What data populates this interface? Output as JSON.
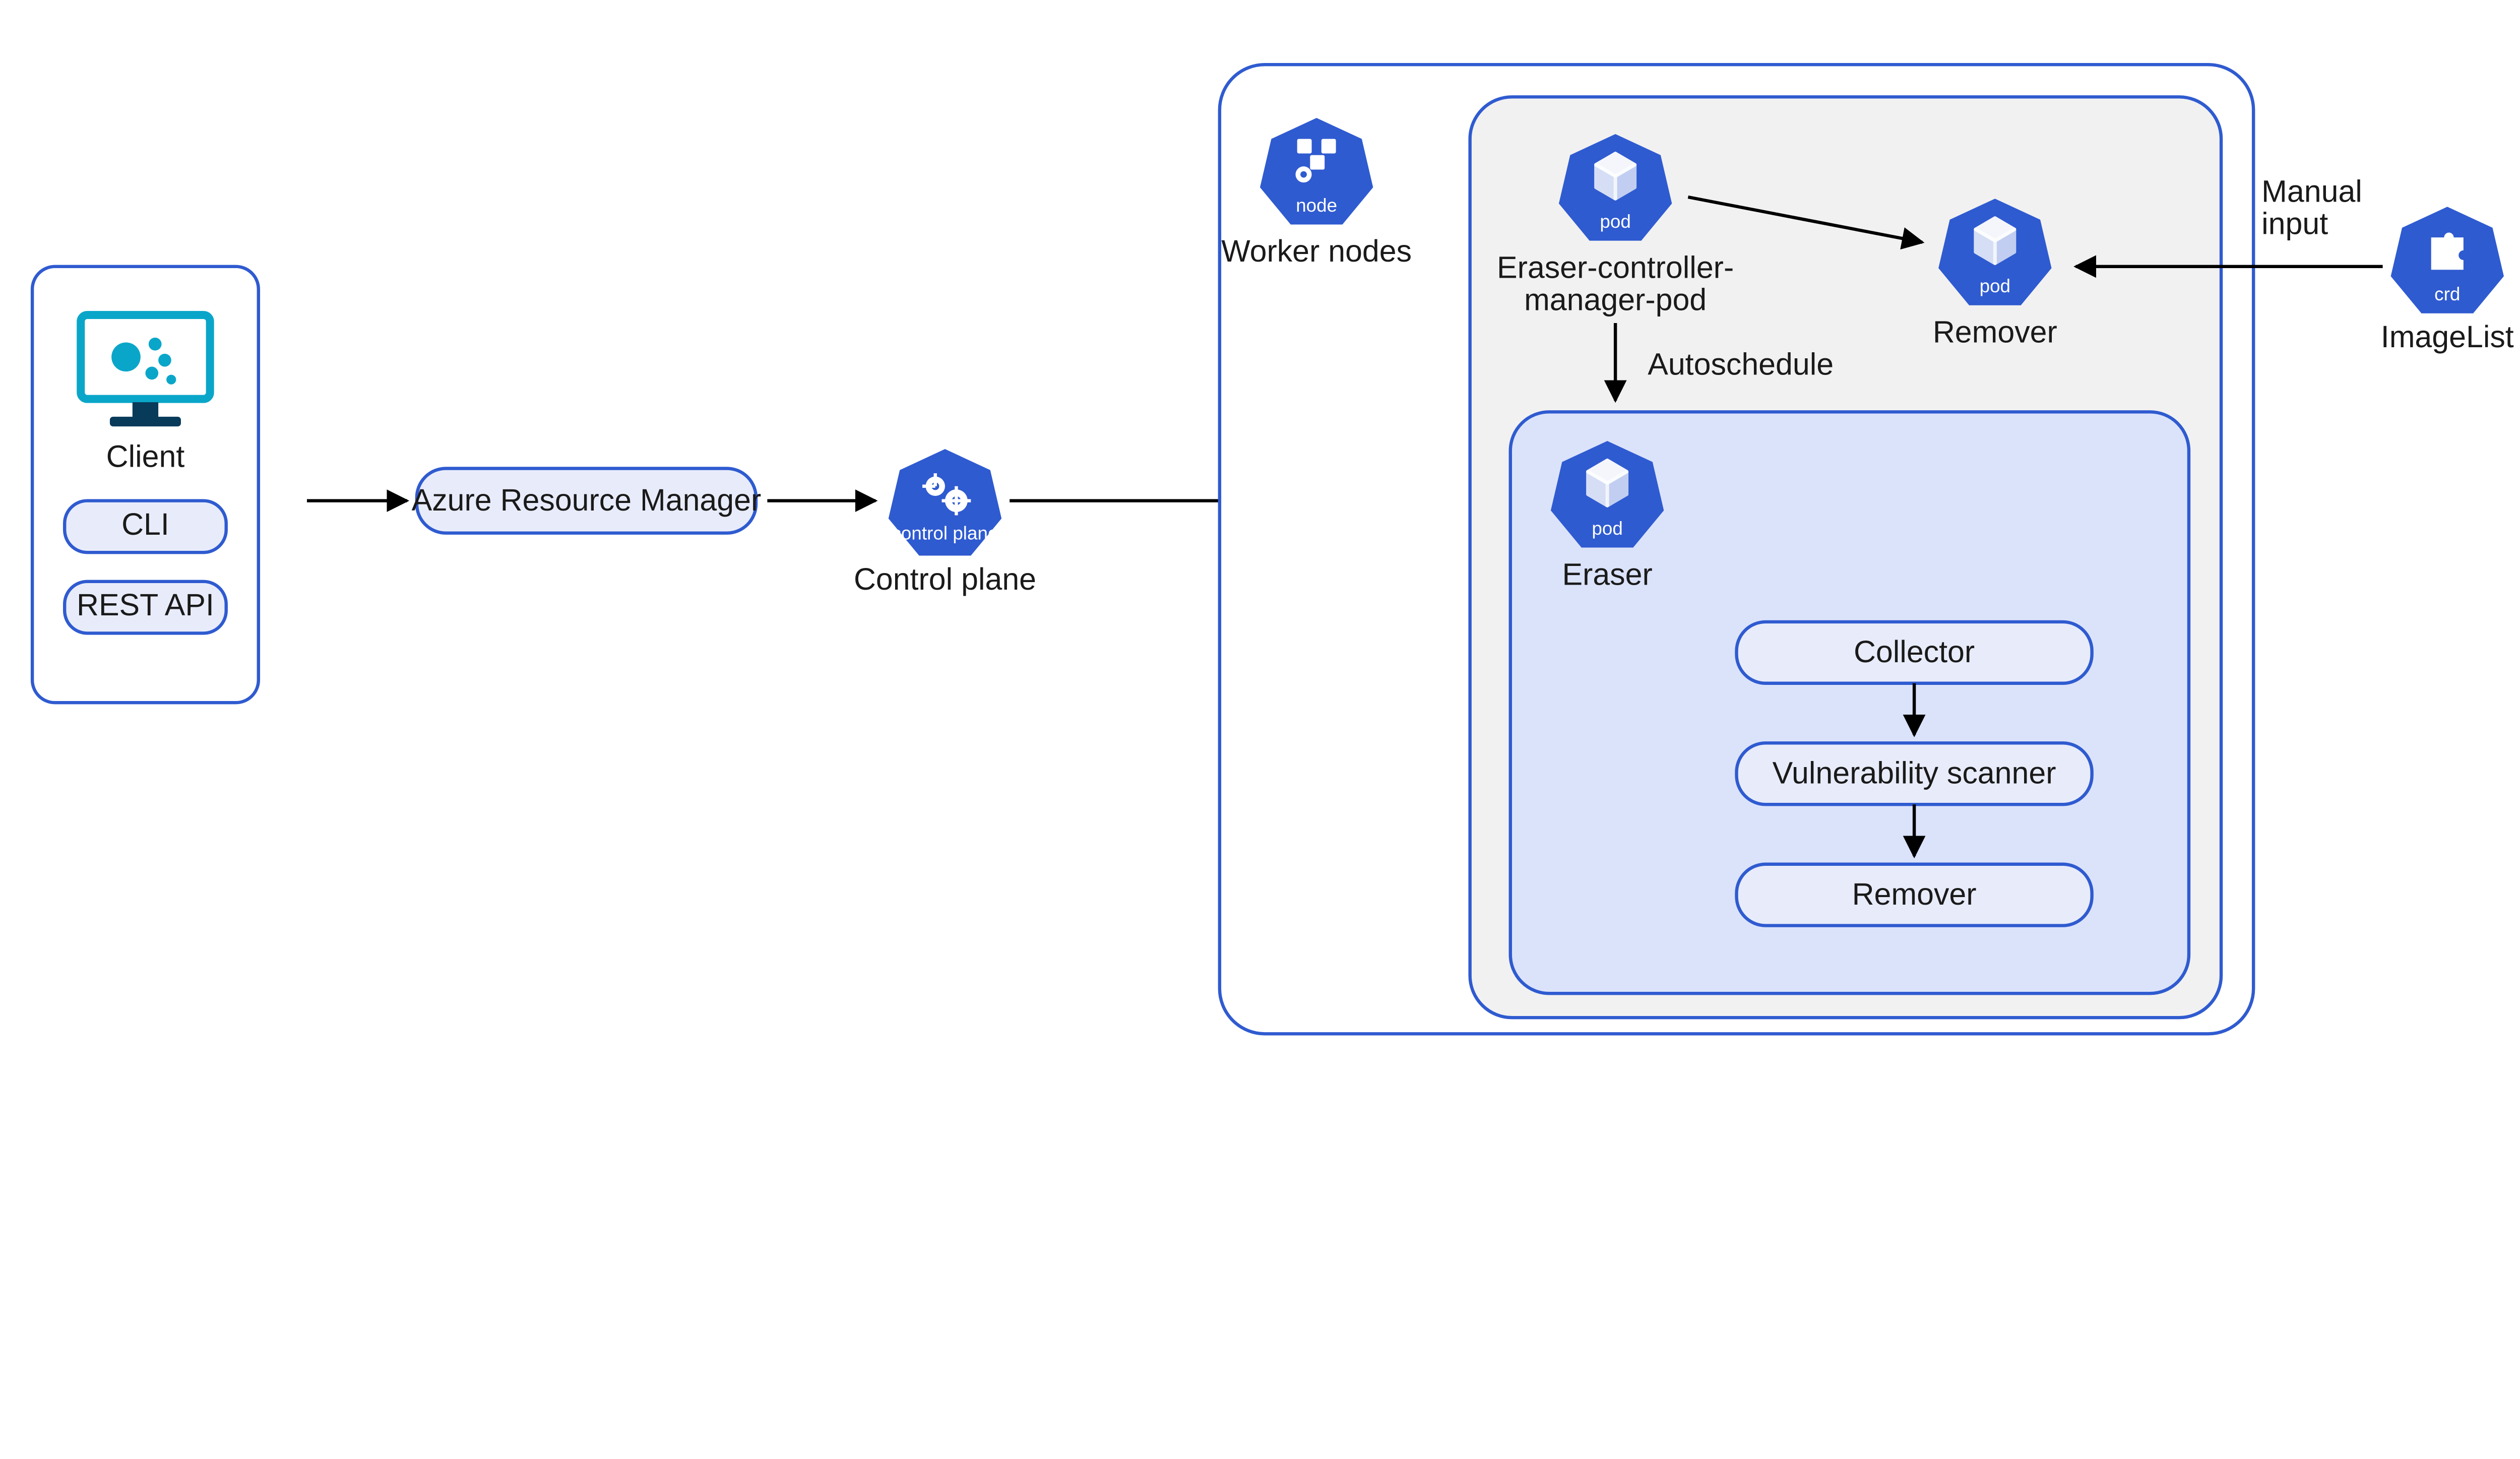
{
  "client": {
    "title": "Client",
    "cli": "CLI",
    "rest": "REST API"
  },
  "arm": "Azure Resource Manager",
  "control_plane": {
    "label": "Control plane",
    "icon_caption": "control plane"
  },
  "worker_nodes": {
    "label": "Worker nodes",
    "icon_caption": "node"
  },
  "eraser_controller": {
    "label_line1": "Eraser-controller-",
    "label_line2": "manager-pod",
    "icon_caption": "pod"
  },
  "remover_pod": {
    "label": "Remover",
    "icon_caption": "pod"
  },
  "eraser_pod": {
    "label": "Eraser",
    "icon_caption": "pod"
  },
  "autoschedule": "Autoschedule",
  "pipeline": {
    "collector": "Collector",
    "scanner": "Vulnerability scanner",
    "remover": "Remover"
  },
  "imagelist": {
    "label": "ImageList",
    "icon_caption": "crd"
  },
  "manual_input": {
    "line1": "Manual",
    "line2": "input"
  },
  "colors": {
    "azure_blue": "#2f5bd0",
    "pill_fill": "#e8ecfa",
    "grey_fill": "#f1f1f1",
    "blue_fill": "#dbe3fb"
  }
}
